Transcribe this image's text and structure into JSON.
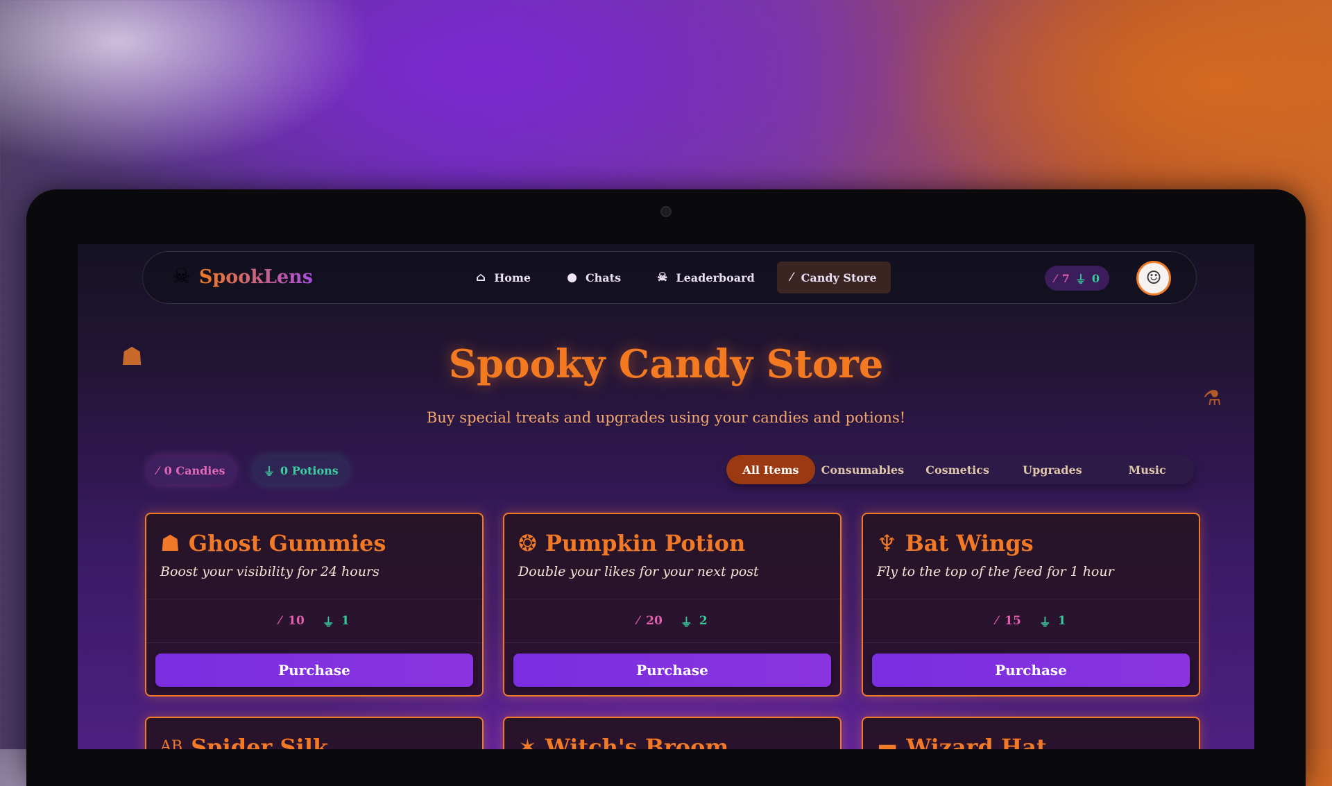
{
  "brand": {
    "name": "SpookLens",
    "icon": "skull-pirate-icon"
  },
  "nav": {
    "links": [
      {
        "label": "Home",
        "icon": "home-icon"
      },
      {
        "label": "Chats",
        "icon": "chat-bubble-icon"
      },
      {
        "label": "Leaderboard",
        "icon": "skull-icon"
      },
      {
        "label": "Candy Store",
        "icon": "candy-cane-icon",
        "active": true
      }
    ],
    "wallet": {
      "candies": "7",
      "potions": "0"
    }
  },
  "header": {
    "title": "Spooky Candy Store",
    "subtitle": "Buy special treats and upgrades using your candies and potions!"
  },
  "balances": {
    "candies": "0 Candies",
    "potions": "0 Potions"
  },
  "tabs": [
    "All Items",
    "Consumables",
    "Cosmetics",
    "Upgrades",
    "Music"
  ],
  "items": [
    {
      "name": "Ghost Gummies",
      "icon": "ghost-icon",
      "desc": "Boost your visibility for 24 hours",
      "candies": "10",
      "potions": "1",
      "button": "Purchase"
    },
    {
      "name": "Pumpkin Potion",
      "icon": "pumpkin-icon",
      "desc": "Double your likes for your next post",
      "candies": "20",
      "potions": "2",
      "button": "Purchase"
    },
    {
      "name": "Bat Wings",
      "icon": "bat-icon",
      "desc": "Fly to the top of the feed for 1 hour",
      "candies": "15",
      "potions": "1",
      "button": "Purchase"
    },
    {
      "name": "Spider Silk",
      "icon": "text-style-icon"
    },
    {
      "name": "Witch's Broom",
      "icon": "sparkle-icon"
    },
    {
      "name": "Wizard Hat",
      "icon": "hat-icon"
    }
  ],
  "colors": {
    "accent": "#f07a2a",
    "purchase": "#7a2ee0",
    "candy": "#e15fae",
    "potion": "#37c99a"
  }
}
